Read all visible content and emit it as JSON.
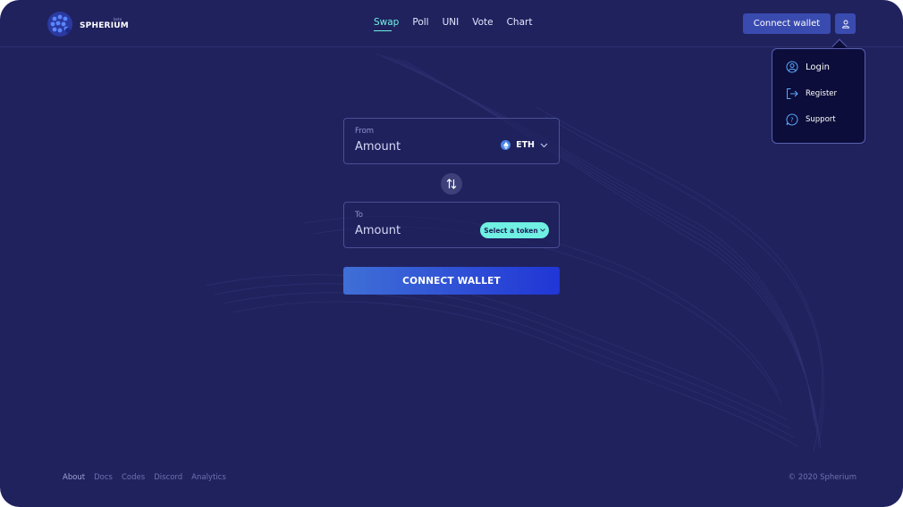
{
  "brand": {
    "name": "SPHERIUM",
    "tag": "beta",
    "logo_icon": "sphere-logo-icon"
  },
  "nav": {
    "items": [
      {
        "label": "Swap",
        "active": true
      },
      {
        "label": "Poll",
        "active": false
      },
      {
        "label": "UNI",
        "active": false
      },
      {
        "label": "Vote",
        "active": false
      },
      {
        "label": "Chart",
        "active": false
      }
    ]
  },
  "header": {
    "connect_label": "Connect wallet",
    "user_icon": "user-icon"
  },
  "user_menu": {
    "items": [
      {
        "label": "Login",
        "icon": "user-circle-icon"
      },
      {
        "label": "Register",
        "icon": "sign-out-icon"
      },
      {
        "label": "Support",
        "icon": "question-bubble-icon"
      }
    ]
  },
  "swap": {
    "from": {
      "label": "From",
      "amount_placeholder": "Amount",
      "token": "ETH"
    },
    "to": {
      "label": "To",
      "amount_placeholder": "Amount",
      "select_label": "Select a token"
    },
    "cta_label": "CONNECT WALLET"
  },
  "footer": {
    "links": [
      "About",
      "Docs",
      "Codes",
      "Discord",
      "Analytics"
    ],
    "copyright": "© 2020 Spherium"
  },
  "colors": {
    "background": "#20225e",
    "accent": "#6ff0e2",
    "button": "#3a4bb0",
    "cta_start": "#3f6fd6",
    "cta_end": "#2136d6"
  }
}
